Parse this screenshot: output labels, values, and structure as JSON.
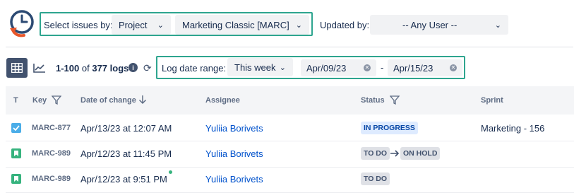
{
  "filters": {
    "select_label": "Select issues by:",
    "select_by_value": "Project",
    "project_value": "Marketing Classic [MARC]",
    "updated_by_label": "Updated by:",
    "updated_by_value": "-- Any User --"
  },
  "toolbar": {
    "range_text": "1-100",
    "of_text": "of",
    "total_logs": "377 logs",
    "date_range_label": "Log date range:",
    "date_range_value": "This week",
    "date_from": "Apr/09/23",
    "date_separator": "-",
    "date_to": "Apr/15/23"
  },
  "table": {
    "headers": {
      "type": "T",
      "key": "Key",
      "date": "Date of change",
      "assignee": "Assignee",
      "status": "Status",
      "sprint": "Sprint"
    },
    "rows": [
      {
        "type_icon": "task-checkbox-icon",
        "key": "MARC-877",
        "date": "Apr/13/23 at 12:07 AM",
        "assignee": "Yuliia Borivets",
        "status_from": "",
        "status_to": "IN PROGRESS",
        "sprint": "Marketing - 156"
      },
      {
        "type_icon": "story-bookmark-icon",
        "key": "MARC-989",
        "date": "Apr/12/23 at 11:45 PM",
        "assignee": "Yuliia Borivets",
        "status_from": "TO DO",
        "status_to": "ON HOLD",
        "sprint": ""
      },
      {
        "type_icon": "story-bookmark-icon",
        "key": "MARC-989",
        "date": "Apr/12/23 at 9:51 PM",
        "assignee": "Yuliia Borivets",
        "status_from": "",
        "status_to": "TO DO",
        "sprint": ""
      }
    ]
  },
  "colors": {
    "accent": "#2ea58f",
    "link": "#0052cc",
    "story_green": "#36b37e",
    "task_blue": "#4bade8",
    "logo_orange": "#e8562a",
    "logo_navy": "#2c4a73"
  }
}
